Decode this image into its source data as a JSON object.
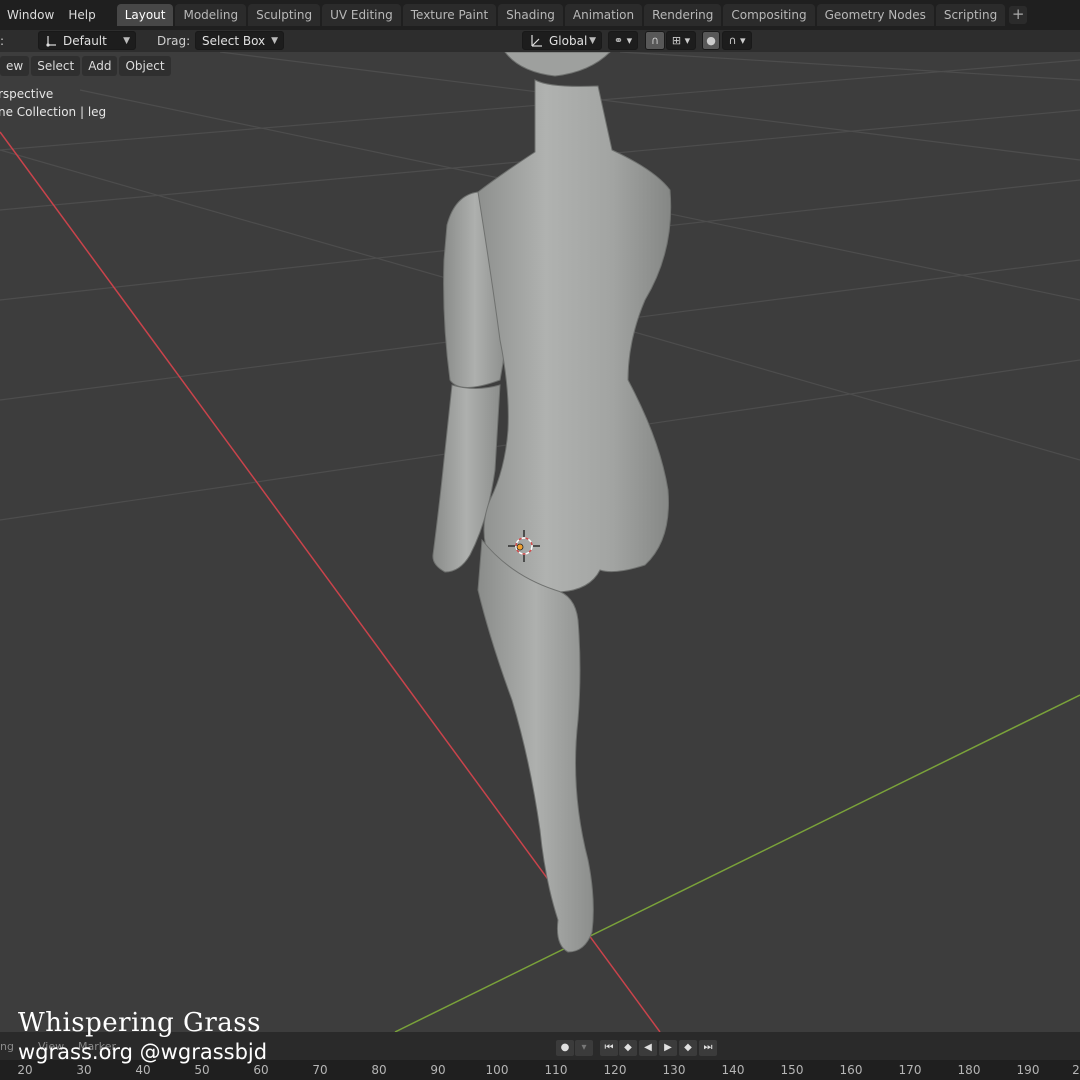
{
  "menubar": {
    "items": [
      "Window",
      "Help"
    ]
  },
  "workspace_tabs": {
    "items": [
      "Layout",
      "Modeling",
      "Sculpting",
      "UV Editing",
      "Texture Paint",
      "Shading",
      "Animation",
      "Rendering",
      "Compositing",
      "Geometry Nodes",
      "Scripting"
    ],
    "active": "Layout",
    "add_label": "+"
  },
  "tool_settings": {
    "mode_label_fragment": ":",
    "orientation_value": "Default",
    "drag_label": "Drag:",
    "drag_value": "Select Box",
    "transform_orientation": "Global"
  },
  "viewport": {
    "menus": [
      "ew",
      "Select",
      "Add",
      "Object"
    ],
    "view_name": "rspective",
    "collection_info": "ne Collection | leg"
  },
  "timeline": {
    "menus": [
      "ng",
      "View",
      "Marker"
    ],
    "ticks": [
      "20",
      "30",
      "40",
      "50",
      "60",
      "70",
      "80",
      "90",
      "100",
      "110",
      "120",
      "130",
      "140",
      "150",
      "160",
      "170",
      "180",
      "190",
      "2"
    ]
  },
  "watermark": {
    "title": "Whispering Grass",
    "subtitle": "wgrass.org @wgrassbjd"
  },
  "colors": {
    "x_axis": "#c9434b",
    "y_axis": "#7aa23a",
    "model": "#a7a9a7",
    "background": "#3d3d3d"
  }
}
